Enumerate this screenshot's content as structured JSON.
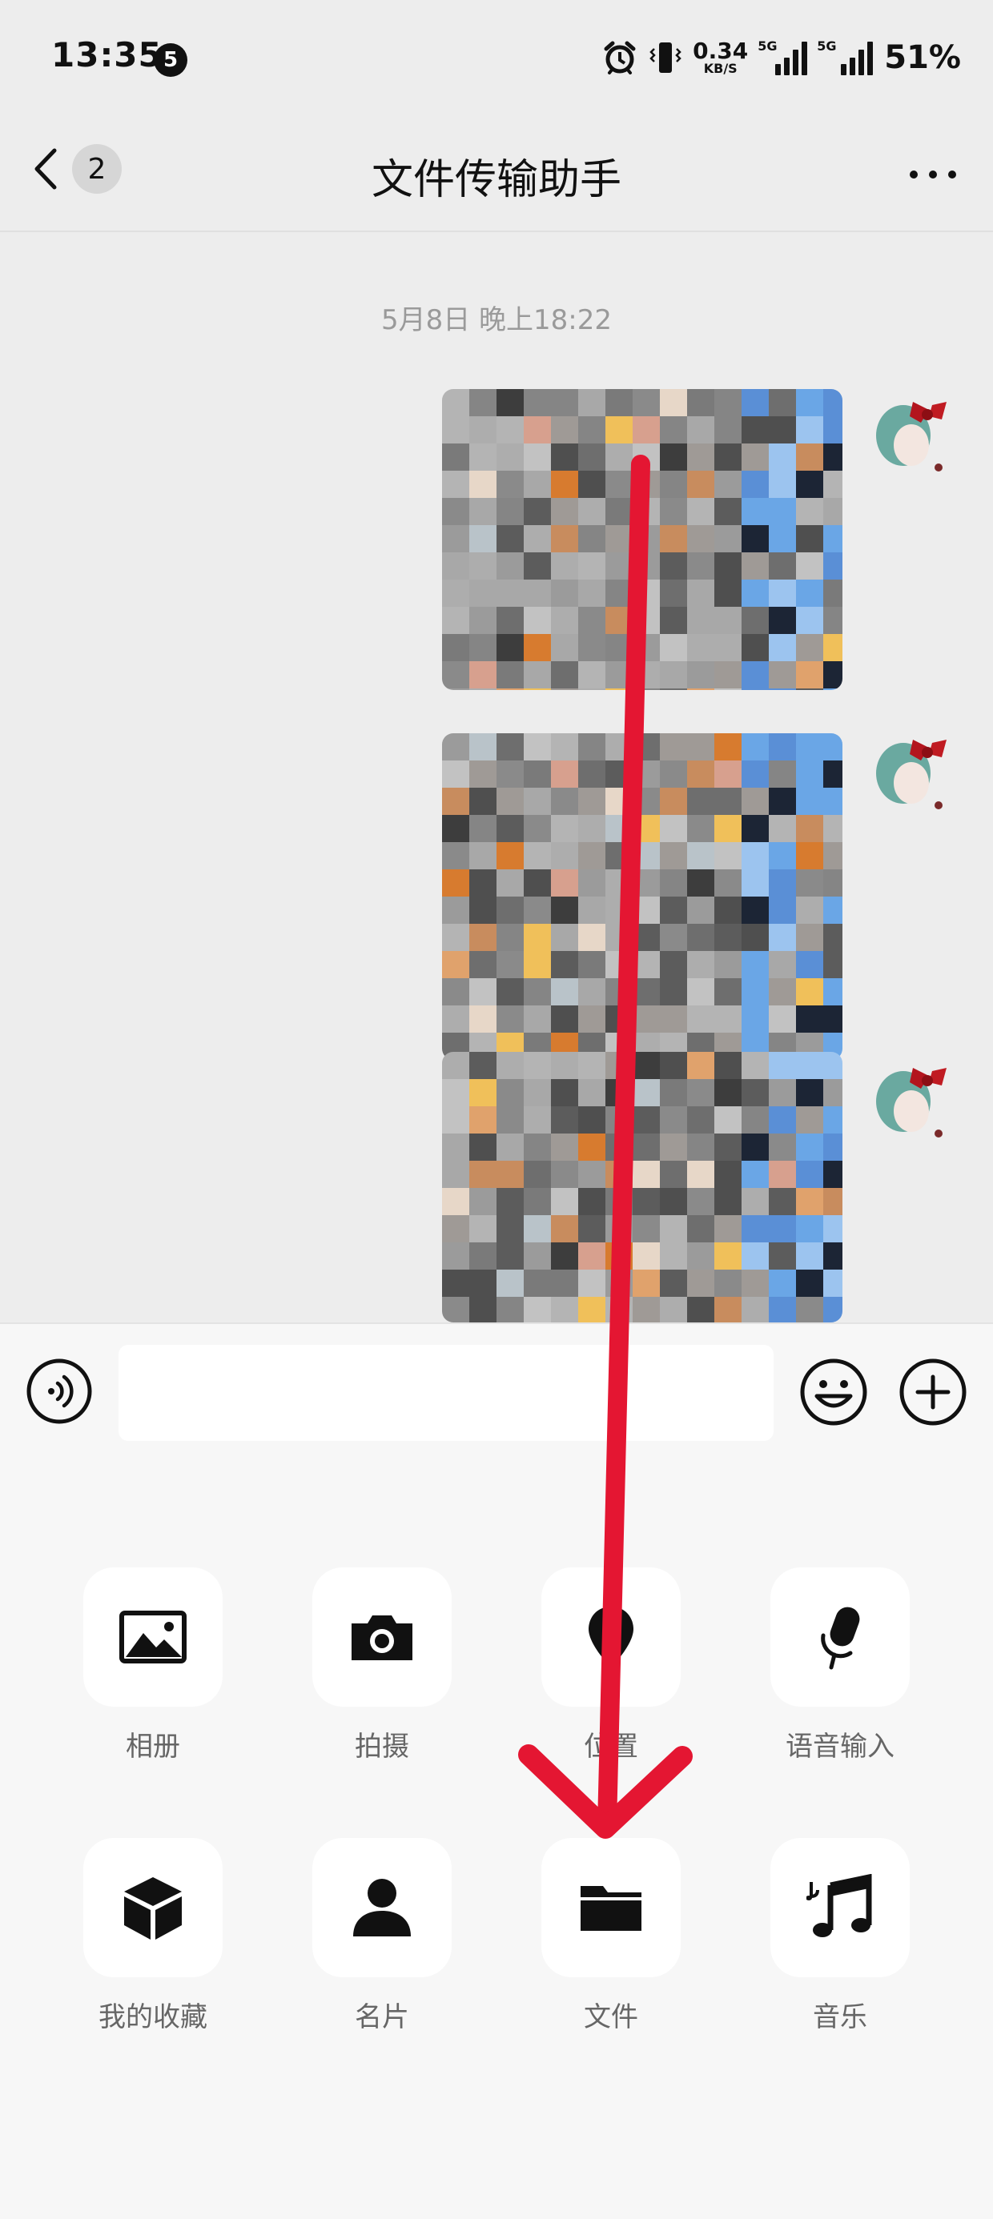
{
  "status_bar": {
    "time": "13:35",
    "notification_count": "5",
    "net_speed_value": "0.34",
    "net_speed_unit": "KB/S",
    "signal_1_label": "5G",
    "signal_2_label": "5G",
    "battery": "51%"
  },
  "nav": {
    "unread_count": "2",
    "title": "文件传输助手"
  },
  "chat": {
    "timestamp": "5月8日 晚上18:22"
  },
  "input": {
    "value": "",
    "placeholder": ""
  },
  "tools": [
    {
      "label": "相册",
      "icon": "photo-album-icon"
    },
    {
      "label": "拍摄",
      "icon": "camera-icon"
    },
    {
      "label": "位置",
      "icon": "location-pin-icon"
    },
    {
      "label": "语音输入",
      "icon": "microphone-icon"
    },
    {
      "label": "我的收藏",
      "icon": "favorites-cube-icon"
    },
    {
      "label": "名片",
      "icon": "contact-card-icon"
    },
    {
      "label": "文件",
      "icon": "folder-icon"
    },
    {
      "label": "音乐",
      "icon": "music-note-icon"
    }
  ],
  "colors": {
    "background": "#ededed",
    "panel": "#f7f7f7",
    "annotation_arrow": "#e41632"
  }
}
